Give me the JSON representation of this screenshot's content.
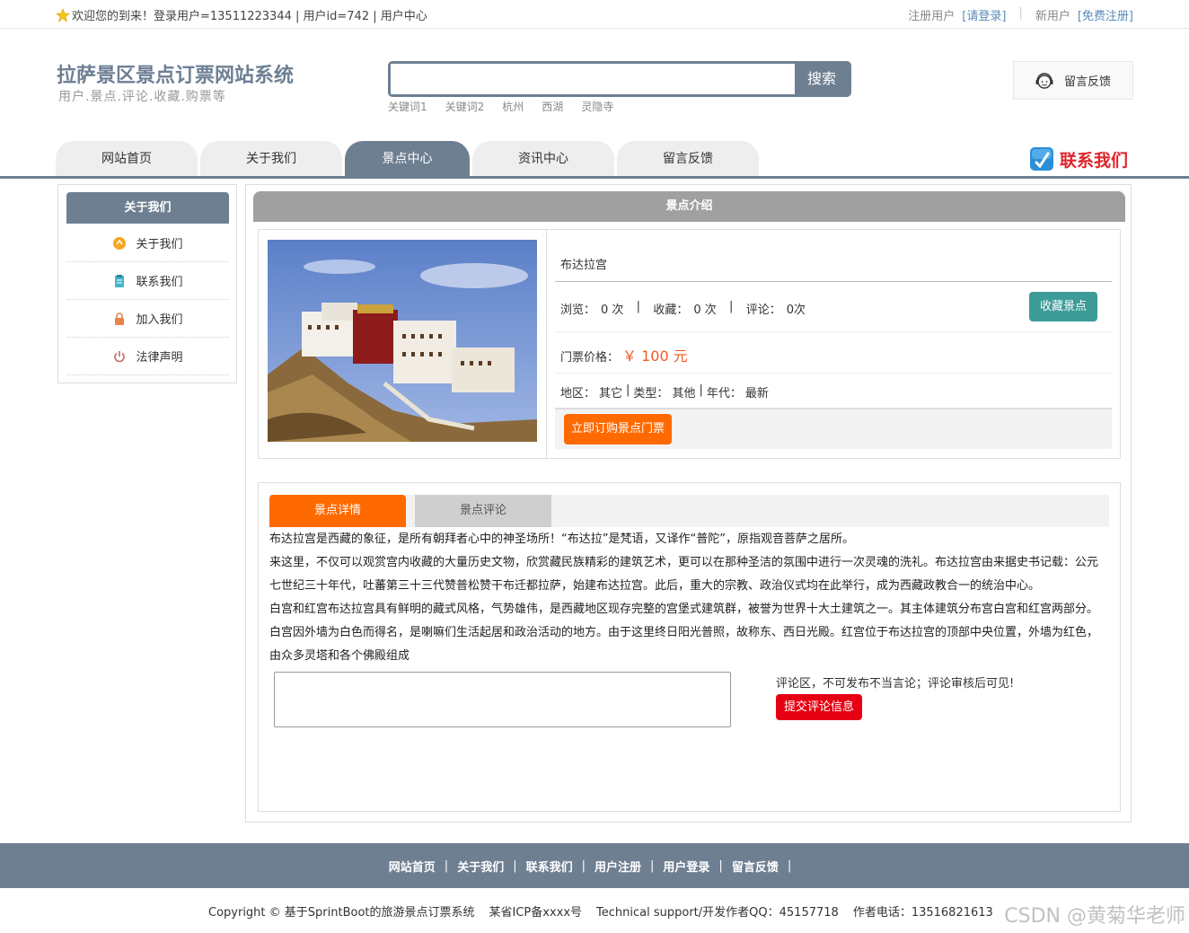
{
  "topbar": {
    "welcome": "欢迎您的到来！登录用户=13511223344 | 用户id=742 | 用户中心",
    "register_prefix": "注册用户",
    "login_link": "[请登录]",
    "new_user_prefix": "新用户",
    "register_link": "[免费注册]"
  },
  "header": {
    "title": "拉萨景区景点订票网站系统",
    "subtitle": "用户.景点.评论.收藏.购票等",
    "search": {
      "placeholder": "",
      "button": "搜索"
    },
    "hotwords": [
      "关键词1",
      "关键词2",
      "杭州",
      "西湖",
      "灵隐寺"
    ],
    "feedback": "留言反馈"
  },
  "nav": {
    "tabs": [
      "网站首页",
      "关于我们",
      "景点中心",
      "资讯中心",
      "留言反馈"
    ],
    "contact": "联系我们"
  },
  "sidebar": {
    "title": "关于我们",
    "items": [
      "关于我们",
      "联系我们",
      "加入我们",
      "法律声明"
    ]
  },
  "main": {
    "title": "景点介绍",
    "spot": {
      "name": "布达拉宫",
      "views_label": "浏览：",
      "views": "0 次",
      "favs_label": "收藏：",
      "favs": "0 次",
      "comments_label": "评论：",
      "comments": "0次",
      "fav_button": "收藏景点",
      "price_label": "门票价格：",
      "price": "￥ 100 元",
      "region_label": "地区：",
      "region": "其它",
      "type_label": "类型：",
      "type": "其他",
      "era_label": "年代：",
      "era": "最新",
      "buy_button": "立即订购景点门票"
    },
    "tabs": [
      "景点详情",
      "景点评论"
    ],
    "description": [
      "布达拉宫是西藏的象征，是所有朝拜者心中的神圣场所！“布达拉”是梵语，又译作“普陀”，原指观音菩萨之居所。",
      "来这里，不仅可以观赏宫内收藏的大量历史文物，欣赏藏民族精彩的建筑艺术，更可以在那种圣洁的氛围中进行一次灵魂的洗礼。布达拉宫由来据史书记载：公元七世纪三十年代，吐蕃第三十三代赞普松赞干布迁都拉萨，始建布达拉宫。此后，重大的宗教、政治仪式均在此举行，成为西藏政教合一的统治中心。",
      "白宫和红宫布达拉宫具有鲜明的藏式风格，气势雄伟，是西藏地区现存完整的宫堡式建筑群，被誉为世界十大土建筑之一。其主体建筑分布宫白宫和红宫两部分。白宫因外墙为白色而得名，是喇嘛们生活起居和政治活动的地方。由于这里终日阳光普照，故称东、西日光殿。红宫位于布达拉宫的顶部中央位置，外墙为红色，由众多灵塔和各个佛殿组成"
    ],
    "comment_note": "评论区，不可发布不当言论；评论审核后可见!",
    "submit_button": "提交评论信息"
  },
  "footer": {
    "links": [
      "网站首页",
      "关于我们",
      "联系我们",
      "用户注册",
      "用户登录",
      "留言反馈"
    ],
    "copyright": "Copyright © 基于SprintBoot的旅游景点订票系统",
    "icp": "某省ICP备xxxx号",
    "support": "Technical support/开发作者QQ：45157718",
    "phone": "作者电话：13516821613",
    "watermark": "CSDN @黄菊华老师"
  },
  "colors": {
    "primary": "#6e7f92",
    "orange": "#ff6a00",
    "teal": "#3d9b98",
    "red": "#e60012",
    "contact_red": "#e0242b"
  }
}
